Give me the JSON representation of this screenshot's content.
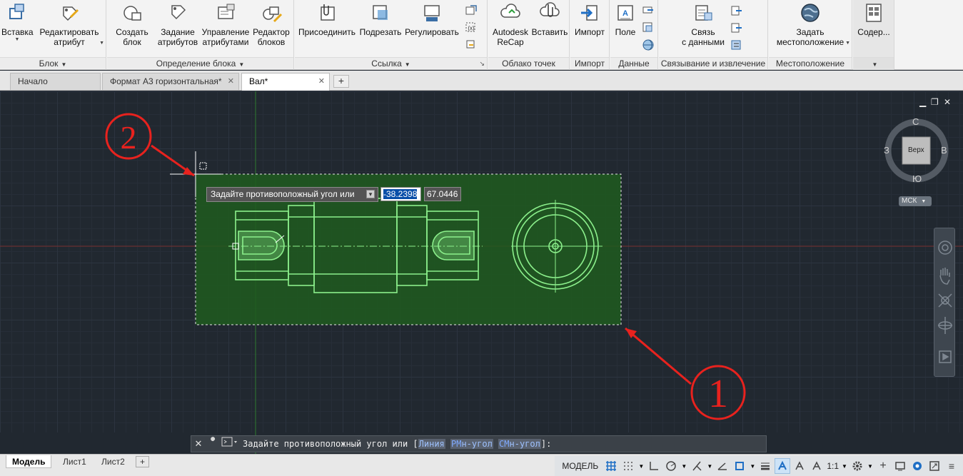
{
  "ribbon": {
    "panels": [
      {
        "title": "Блок",
        "buttons": [
          {
            "label": "Вставка"
          },
          {
            "label": "Редактировать атрибут",
            "l1": "Редактировать",
            "l2": "атрибут"
          }
        ]
      },
      {
        "title": "Определение блока",
        "buttons": [
          {
            "l1": "Создать",
            "l2": "блок"
          },
          {
            "l1": "Задание",
            "l2": "атрибутов"
          },
          {
            "l1": "Управление",
            "l2": "атрибутами"
          },
          {
            "l1": "Редактор",
            "l2": "блоков"
          }
        ]
      },
      {
        "title": "Ссылка",
        "buttons": [
          {
            "label": "Присоединить"
          },
          {
            "label": "Подрезать"
          },
          {
            "label": "Регулировать"
          }
        ]
      },
      {
        "title": "Облако точек",
        "buttons": [
          {
            "l1": "Autodesk",
            "l2": "ReCap"
          },
          {
            "label": "Вставить"
          }
        ]
      },
      {
        "title": "Импорт",
        "buttons": [
          {
            "label": "Импорт"
          }
        ]
      },
      {
        "title": "Данные",
        "buttons": [
          {
            "label": "Поле"
          }
        ]
      },
      {
        "title": "Связывание и извлечение",
        "buttons": [
          {
            "l1": "Связь",
            "l2": "с данными"
          }
        ]
      },
      {
        "title": "Местоположение",
        "buttons": [
          {
            "l1": "Задать",
            "l2": "местоположение"
          }
        ]
      },
      {
        "title": "",
        "buttons": [
          {
            "label": "Содер..."
          }
        ]
      }
    ]
  },
  "file_tabs": [
    {
      "label": "Начало",
      "active": false
    },
    {
      "label": "Формат А3 горизонтальная*",
      "active": false
    },
    {
      "label": "Вал*",
      "active": true
    }
  ],
  "tab_add": "+",
  "tab_close": "✕",
  "window_controls": {
    "minimize": "▁",
    "restore": "❐",
    "close": "✕"
  },
  "viewcube": {
    "north": "С",
    "south": "Ю",
    "west": "З",
    "east": "В",
    "face": "Верх",
    "ucs": "МСК"
  },
  "dynamic_input": {
    "prompt": "Задайте противоположный угол или",
    "x_value": "-38.2398",
    "y_value": "67.0446",
    "expand_button": "▾"
  },
  "annotations": {
    "marker1": "1",
    "marker2": "2"
  },
  "command_line": {
    "prompt": "Задайте противоположный угол или [",
    "options": [
      {
        "key": "",
        "rest": "Линия"
      },
      {
        "key": "РМ",
        "rest": "н-угол"
      },
      {
        "key": "СМ",
        "rest": "н-угол"
      }
    ],
    "suffix": "]:",
    "close": "✕",
    "settings": "🔧"
  },
  "layout_tabs": [
    {
      "label": "Модель",
      "active": true
    },
    {
      "label": "Лист1",
      "active": false
    },
    {
      "label": "Лист2",
      "active": false
    }
  ],
  "layout_add": "+",
  "status": {
    "model_label": "МОДЕЛЬ",
    "scale_label": "1:1"
  },
  "colors": {
    "selection_fill": "#1e5a1e",
    "geometry": "#8cf08c",
    "background": "#212830",
    "ribbon": "#f3f3f3"
  }
}
